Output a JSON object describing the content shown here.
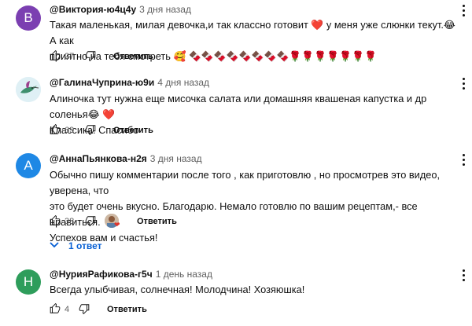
{
  "comments": [
    {
      "avatar_letter": "В",
      "avatar_color": "#7b3fb1",
      "author": "@Виктория-ю4ц4у",
      "time": "3 дня назад",
      "text_line1": "Такая маленькая, милая девочка,и так классно готовит ❤️ у меня уже слюнки текут.😂 А как",
      "text_line2": "приятно на тебя смотреть 🥰 🍫🍫🍫🍫🍫🍫🍫🍫🌹🌹🌹🌹🌹🌹🌹",
      "likes": "27",
      "reply_label": "Ответить"
    },
    {
      "avatar_letter": "",
      "avatar_color": "#dff0f5",
      "author": "@ГалинаЧуприна-ю9и",
      "time": "4 дня назад",
      "text_line1": "Алиночка тут нужна еще мисочка салата или домашняя квашеная капустка и др соленья😂 ❤️",
      "text_line2": "Классика. Спасибо",
      "likes": "69",
      "reply_label": "Ответить"
    },
    {
      "avatar_letter": "А",
      "avatar_color": "#1e88e5",
      "author": "@АннаПьянкова-н2я",
      "time": "3 дня назад",
      "text_line1": "Обычно пишу комментарии после того , как приготовлю , но просмотрев это видео, уверена, что",
      "text_line2": "это будет очень вкусно. Благодарю. Немало готовлю по вашим рецептам,- все нравиться.",
      "text_line3": "Успехов вам и счастья!",
      "likes": "38",
      "reply_label": "Ответить",
      "replies_label": "1 ответ"
    },
    {
      "avatar_letter": "Н",
      "avatar_color": "#2e9d5b",
      "author": "@НурияРафикова-г5ч",
      "time": "1 день назад",
      "text_line1": "Всегда  улыбчивая, солнечная! Молодчина! Хозяюшка!",
      "likes": "4",
      "reply_label": "Ответить"
    }
  ],
  "icons": {
    "like": "thumbs-up-icon",
    "dislike": "thumbs-down-icon",
    "menu": "more-vert-icon",
    "expand": "chevron-down-icon"
  }
}
